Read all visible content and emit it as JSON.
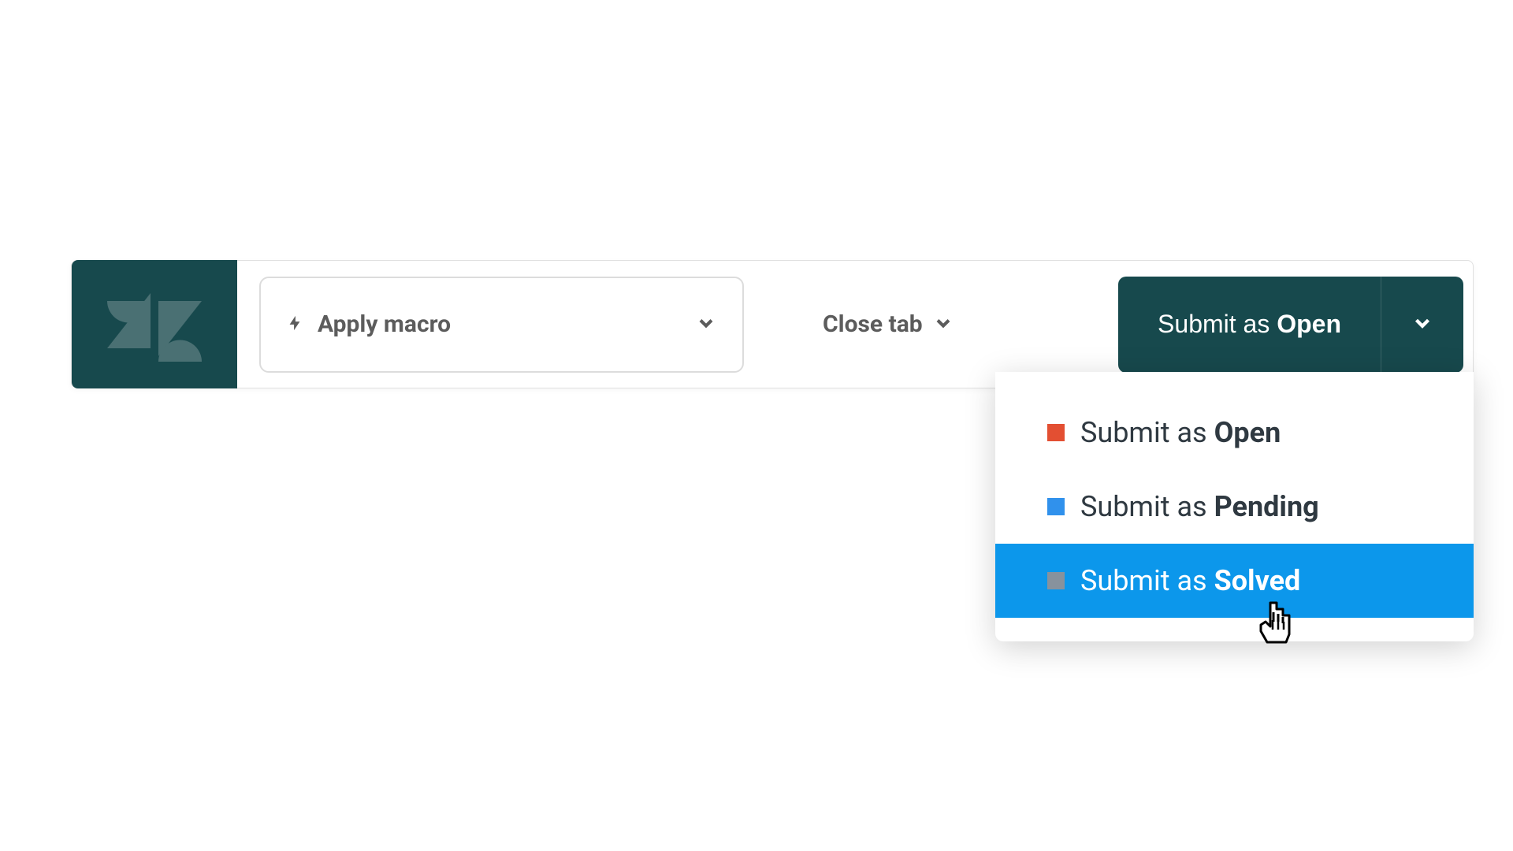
{
  "toolbar": {
    "macro": {
      "label": "Apply macro"
    },
    "close_tab": {
      "label": "Close tab"
    },
    "submit": {
      "prefix": "Submit as ",
      "status": "Open"
    }
  },
  "dropdown": {
    "items": [
      {
        "prefix": "Submit as ",
        "status": "Open",
        "color": "#e34f32",
        "highlighted": false
      },
      {
        "prefix": "Submit as ",
        "status": "Pending",
        "color": "#3091ec",
        "highlighted": false
      },
      {
        "prefix": "Submit as ",
        "status": "Solved",
        "color": "#87929d",
        "highlighted": true
      }
    ]
  }
}
